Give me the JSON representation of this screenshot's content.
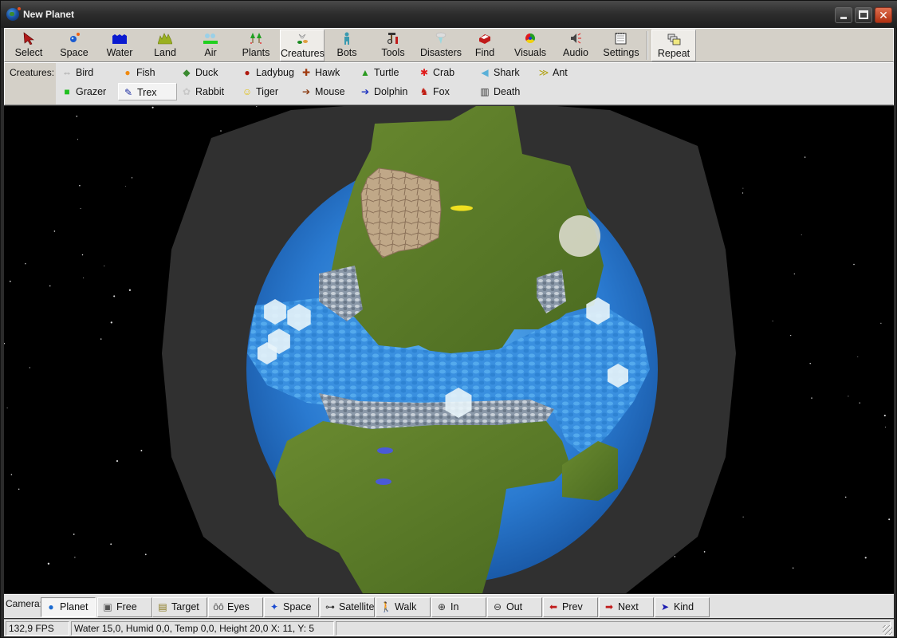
{
  "window": {
    "title": "New Planet",
    "controls": {
      "minimize": "_",
      "maximize": "□",
      "close": "✕"
    }
  },
  "toolbar": {
    "items": [
      {
        "label": "Select",
        "icon": "arrow-cursor-icon"
      },
      {
        "label": "Space",
        "icon": "space-icon"
      },
      {
        "label": "Water",
        "icon": "water-icon"
      },
      {
        "label": "Land",
        "icon": "land-icon"
      },
      {
        "label": "Air",
        "icon": "air-icon"
      },
      {
        "label": "Plants",
        "icon": "plants-icon"
      },
      {
        "label": "Creatures",
        "icon": "creatures-icon",
        "active": true
      },
      {
        "label": "Bots",
        "icon": "bot-icon"
      },
      {
        "label": "Tools",
        "icon": "tools-icon"
      },
      {
        "label": "Disasters",
        "icon": "tornado-icon"
      },
      {
        "label": "Find",
        "icon": "find-icon"
      },
      {
        "label": "Visuals",
        "icon": "color-wheel-icon"
      },
      {
        "label": "Audio",
        "icon": "speaker-icon"
      },
      {
        "label": "Settings",
        "icon": "settings-notepad-icon"
      }
    ],
    "repeat": {
      "label": "Repeat",
      "icon": "repeat-blocks-icon",
      "active": true
    }
  },
  "creatures": {
    "caption": "Creatures:",
    "items": [
      {
        "label": "Bird",
        "icon": "bird-icon",
        "glyph": "⇔",
        "color": "#9a9a9a"
      },
      {
        "label": "Fish",
        "icon": "fish-icon",
        "glyph": "●",
        "color": "#f08a10"
      },
      {
        "label": "Duck",
        "icon": "duck-icon",
        "glyph": "◆",
        "color": "#3a8a30"
      },
      {
        "label": "Ladybug",
        "icon": "ladybug-icon",
        "glyph": "●",
        "color": "#b01a10"
      },
      {
        "label": "Hawk",
        "icon": "hawk-icon",
        "glyph": "✚",
        "color": "#a03a10"
      },
      {
        "label": "Turtle",
        "icon": "turtle-icon",
        "glyph": "▲",
        "color": "#2a9a20"
      },
      {
        "label": "Crab",
        "icon": "crab-icon",
        "glyph": "✱",
        "color": "#e01a1a"
      },
      {
        "label": "Shark",
        "icon": "shark-icon",
        "glyph": "◀",
        "color": "#5ab0d8"
      },
      {
        "label": "Ant",
        "icon": "ant-icon",
        "glyph": "≫",
        "color": "#b0a010"
      },
      {
        "label": "Grazer",
        "icon": "grazer-icon",
        "glyph": "■",
        "color": "#20c020"
      },
      {
        "label": "Trex",
        "icon": "trex-icon",
        "glyph": "✎",
        "color": "#1a2aa0",
        "active": true
      },
      {
        "label": "Rabbit",
        "icon": "rabbit-icon",
        "glyph": "✿",
        "color": "#c8c8c8"
      },
      {
        "label": "Tiger",
        "icon": "tiger-icon",
        "glyph": "☺",
        "color": "#e0c010"
      },
      {
        "label": "Mouse",
        "icon": "mouse-icon",
        "glyph": "➔",
        "color": "#8a3a10"
      },
      {
        "label": "Dolphin",
        "icon": "dolphin-icon",
        "glyph": "➔",
        "color": "#1a30c0"
      },
      {
        "label": "Fox",
        "icon": "fox-icon",
        "glyph": "♞",
        "color": "#c01a10"
      },
      {
        "label": "Death",
        "icon": "trash-can-icon",
        "glyph": "▥",
        "color": "#333333"
      }
    ]
  },
  "camera": {
    "caption": "Camera:",
    "items": [
      {
        "label": "Planet",
        "icon": "globe-icon",
        "glyph": "●",
        "color": "#1a6ad0",
        "active": true
      },
      {
        "label": "Free",
        "icon": "camera-icon",
        "glyph": "▣",
        "color": "#555555"
      },
      {
        "label": "Target",
        "icon": "target-notepad-icon",
        "glyph": "▤",
        "color": "#8a7a20"
      },
      {
        "label": "Eyes",
        "icon": "eyes-icon",
        "glyph": "ȏȏ",
        "color": "#555555"
      },
      {
        "label": "Space",
        "icon": "space-icon",
        "glyph": "✦",
        "color": "#1a4ad0"
      },
      {
        "label": "Satellite",
        "icon": "satellite-icon",
        "glyph": "⊶",
        "color": "#333333"
      },
      {
        "label": "Walk",
        "icon": "walk-icon",
        "glyph": "🚶",
        "color": "#111111"
      },
      {
        "label": "In",
        "icon": "zoom-in-icon",
        "glyph": "⊕",
        "color": "#333333"
      },
      {
        "label": "Out",
        "icon": "zoom-out-icon",
        "glyph": "⊖",
        "color": "#333333"
      },
      {
        "label": "Prev",
        "icon": "arrow-left-icon",
        "glyph": "⬅",
        "color": "#c01a1a"
      },
      {
        "label": "Next",
        "icon": "arrow-right-icon",
        "glyph": "➡",
        "color": "#c01a1a"
      },
      {
        "label": "Kind",
        "icon": "kind-arrow-icon",
        "glyph": "➤",
        "color": "#1a1ab0"
      }
    ]
  },
  "status": {
    "fps": "132,9 FPS",
    "info": "Water 15,0, Humid 0,0, Temp 0,0, Height 20,0 X: 11, Y: 5",
    "extra": ""
  },
  "colors": {
    "space": "#000000",
    "atmosphere": "#303030",
    "ocean": "#2a7ad0",
    "land": "#5a7a28",
    "rock": "#b8a080",
    "ice": "#e8f4fa"
  }
}
